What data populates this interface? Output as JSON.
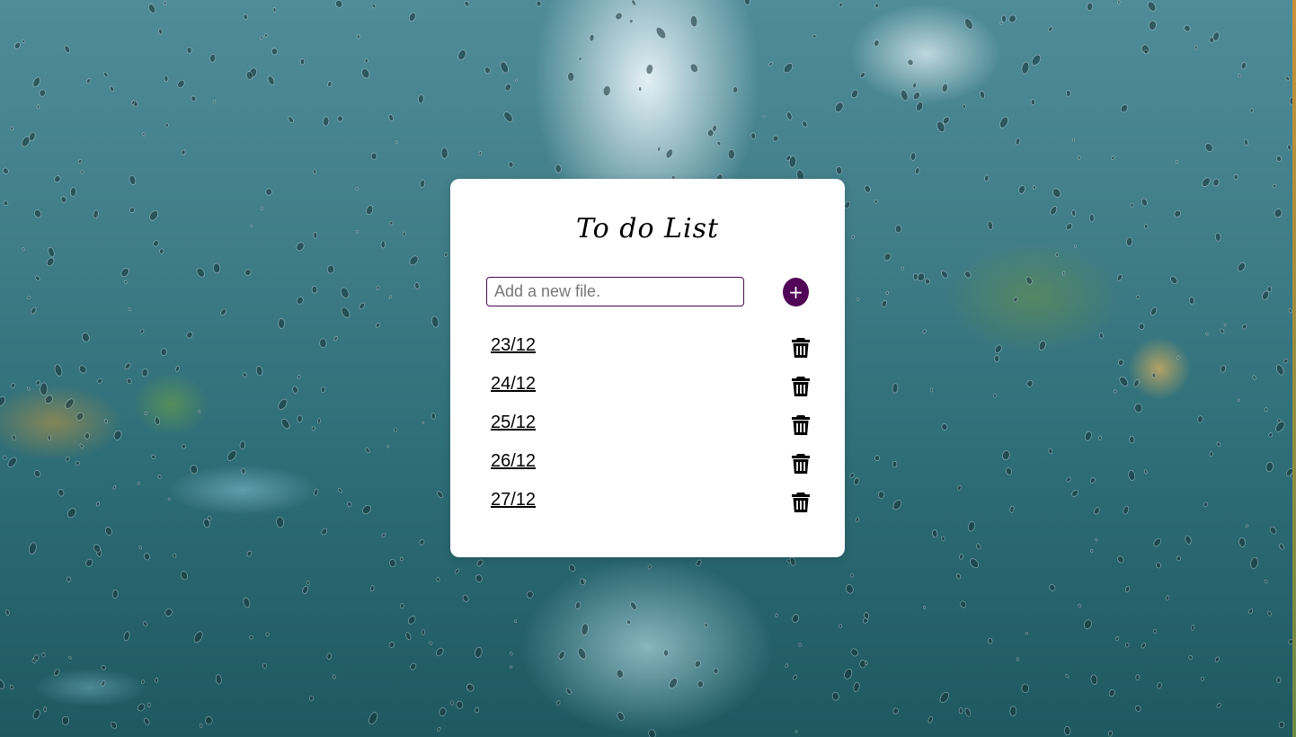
{
  "app": {
    "title": "To do List"
  },
  "new_item": {
    "placeholder": "Add a new file.",
    "value": "",
    "add_label": "+"
  },
  "items": [
    {
      "label": "23/12",
      "icon": "trash-icon"
    },
    {
      "label": "24/12",
      "icon": "trash-icon"
    },
    {
      "label": "25/12",
      "icon": "trash-icon"
    },
    {
      "label": "26/12",
      "icon": "trash-icon"
    },
    {
      "label": "27/12",
      "icon": "trash-icon"
    }
  ],
  "colors": {
    "accent": "#520657",
    "card": "#ffffff",
    "background": "#3e7c86"
  }
}
